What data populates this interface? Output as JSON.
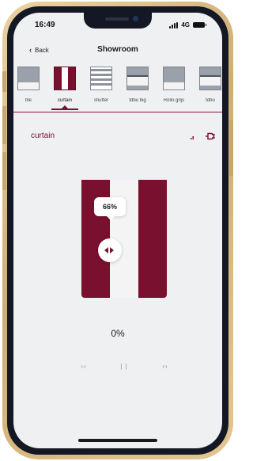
{
  "status_bar": {
    "time": "16:49",
    "network": "4G"
  },
  "header": {
    "back_label": "Back",
    "title": "Showroom"
  },
  "device_types": [
    {
      "label": "ble",
      "icon": "blind-icon",
      "active": false
    },
    {
      "label": "curtain",
      "icon": "curtain-icon",
      "active": true
    },
    {
      "label": "shutter",
      "icon": "shutter-icon",
      "active": false
    },
    {
      "label": "tdbu big",
      "icon": "tdbu-icon",
      "active": false
    },
    {
      "label": "Rollo grijs",
      "icon": "blind-icon",
      "active": false
    },
    {
      "label": "tdbu",
      "icon": "tdbu-icon",
      "active": false
    }
  ],
  "device": {
    "name": "curtain"
  },
  "curtain": {
    "tooltip": "66%",
    "tooltip_value": 0.66,
    "position": "0%"
  },
  "controls": {
    "close": "›‹",
    "stop": "| |",
    "open": "‹›"
  },
  "colors": {
    "accent": "#7a1030",
    "background": "#eff0f2",
    "frame": "#cfae73"
  }
}
